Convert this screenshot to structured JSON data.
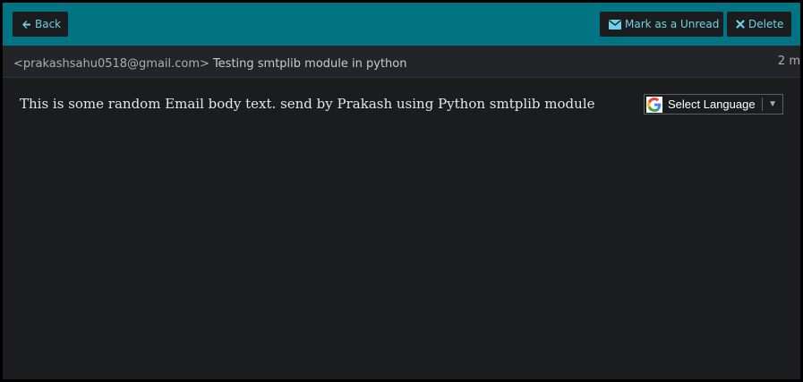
{
  "toolbar": {
    "back_label": "Back",
    "mark_unread_label": "Mark as a Unread",
    "delete_label": "Delete"
  },
  "message": {
    "from": "<prakashsahu0518@gmail.com>",
    "subject": "Testing smtplib module in python",
    "time": "2 m",
    "body": "This is some random Email body text. send by Prakash using Python smtplib module"
  },
  "translate": {
    "label": "Select Language",
    "arrow": "▼"
  },
  "colors": {
    "toolbar": "#007483",
    "accent_text": "#6fd0e6",
    "background": "#1b1c1e"
  },
  "icons": {
    "back": "arrow-left-icon",
    "unread": "envelope-icon",
    "delete": "close-icon",
    "translate": "google-g-icon"
  }
}
